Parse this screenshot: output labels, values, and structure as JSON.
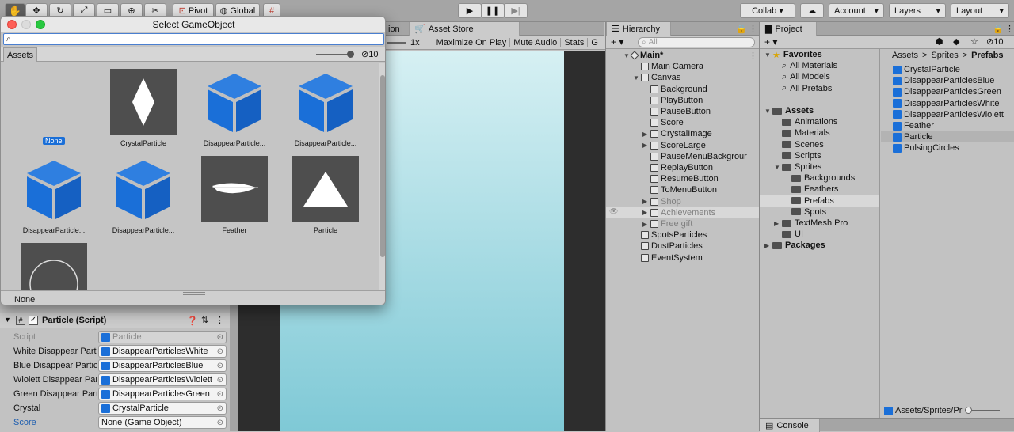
{
  "toolbar": {
    "pivot": "Pivot",
    "global": "Global",
    "collab": "Collab ▾",
    "account": "Account",
    "layers": "Layers",
    "layout": "Layout"
  },
  "game_view": {
    "tab_asset_store": "Asset Store",
    "zoom": "1x",
    "maximize": "Maximize On Play",
    "mute": "Mute Audio",
    "stats": "Stats",
    "gizmos": "G"
  },
  "hierarchy": {
    "title": "Hierarchy",
    "search_placeholder": "All",
    "add": "+ ▾",
    "items": [
      {
        "label": "Main*",
        "depth": 0,
        "arrow": "▼",
        "bold": true,
        "icon": "unity-scene-icon"
      },
      {
        "label": "Main Camera",
        "depth": 1,
        "arrow": "",
        "icon": "cube-icon"
      },
      {
        "label": "Canvas",
        "depth": 1,
        "arrow": "▼",
        "icon": "cube-icon"
      },
      {
        "label": "Background",
        "depth": 2,
        "arrow": "",
        "icon": "cube-icon"
      },
      {
        "label": "PlayButton",
        "depth": 2,
        "arrow": "",
        "icon": "cube-icon"
      },
      {
        "label": "PauseButton",
        "depth": 2,
        "arrow": "",
        "icon": "cube-icon"
      },
      {
        "label": "Score",
        "depth": 2,
        "arrow": "",
        "icon": "cube-icon"
      },
      {
        "label": "CrystalImage",
        "depth": 2,
        "arrow": "▶",
        "icon": "cube-icon"
      },
      {
        "label": "ScoreLarge",
        "depth": 2,
        "arrow": "▶",
        "icon": "cube-icon"
      },
      {
        "label": "PauseMenuBackgrour",
        "depth": 2,
        "arrow": "",
        "icon": "cube-icon"
      },
      {
        "label": "ReplayButton",
        "depth": 2,
        "arrow": "",
        "icon": "cube-icon"
      },
      {
        "label": "ResumeButton",
        "depth": 2,
        "arrow": "",
        "icon": "cube-icon"
      },
      {
        "label": "ToMenuButton",
        "depth": 2,
        "arrow": "",
        "icon": "cube-icon"
      },
      {
        "label": "Shop",
        "depth": 2,
        "arrow": "▶",
        "gray": true,
        "icon": "cube-icon"
      },
      {
        "label": "Achievements",
        "depth": 2,
        "arrow": "▶",
        "gray": true,
        "selected": true,
        "icon": "cube-icon"
      },
      {
        "label": "Free gift",
        "depth": 2,
        "arrow": "▶",
        "gray": true,
        "icon": "cube-icon"
      },
      {
        "label": "SpotsParticles",
        "depth": 1,
        "arrow": "",
        "icon": "cube-icon"
      },
      {
        "label": "DustParticles",
        "depth": 1,
        "arrow": "",
        "icon": "cube-icon"
      },
      {
        "label": "EventSystem",
        "depth": 1,
        "arrow": "",
        "icon": "cube-icon"
      }
    ]
  },
  "project": {
    "title": "Project",
    "add": "+ ▾",
    "count": "10",
    "tree": [
      {
        "label": "Favorites",
        "depth": 0,
        "arrow": "▼",
        "bold": true,
        "icon": "star-icon"
      },
      {
        "label": "All Materials",
        "depth": 1,
        "icon": "search-icon"
      },
      {
        "label": "All Models",
        "depth": 1,
        "icon": "search-icon"
      },
      {
        "label": "All Prefabs",
        "depth": 1,
        "icon": "search-icon"
      },
      {
        "label": "",
        "depth": 0,
        "icon": ""
      },
      {
        "label": "Assets",
        "depth": 0,
        "arrow": "▼",
        "bold": true,
        "icon": "folder-icon"
      },
      {
        "label": "Animations",
        "depth": 1,
        "icon": "folder-icon"
      },
      {
        "label": "Materials",
        "depth": 1,
        "icon": "folder-icon"
      },
      {
        "label": "Scenes",
        "depth": 1,
        "icon": "folder-icon"
      },
      {
        "label": "Scripts",
        "depth": 1,
        "icon": "folder-icon"
      },
      {
        "label": "Sprites",
        "depth": 1,
        "arrow": "▼",
        "icon": "folder-icon"
      },
      {
        "label": "Backgrounds",
        "depth": 2,
        "icon": "folder-icon"
      },
      {
        "label": "Feathers",
        "depth": 2,
        "icon": "folder-icon"
      },
      {
        "label": "Prefabs",
        "depth": 2,
        "icon": "folder-icon",
        "selected": true
      },
      {
        "label": "Spots",
        "depth": 2,
        "icon": "folder-icon"
      },
      {
        "label": "TextMesh Pro",
        "depth": 1,
        "arrow": "▶",
        "icon": "folder-icon"
      },
      {
        "label": "UI",
        "depth": 1,
        "icon": "folder-icon"
      },
      {
        "label": "Packages",
        "depth": 0,
        "arrow": "▶",
        "bold": true,
        "icon": "folder-icon"
      }
    ],
    "breadcrumb": [
      "Assets",
      ">",
      "Sprites",
      ">",
      "Prefabs"
    ],
    "files": [
      {
        "label": "CrystalParticle"
      },
      {
        "label": "DisappearParticlesBlue"
      },
      {
        "label": "DisappearParticlesGreen"
      },
      {
        "label": "DisappearParticlesWhite"
      },
      {
        "label": "DisappearParticlesWiolett"
      },
      {
        "label": "Feather"
      },
      {
        "label": "Particle",
        "selected": true
      },
      {
        "label": "PulsingCircles"
      }
    ],
    "footer_path": "Assets/Sprites/Pr",
    "console": "Console"
  },
  "inspector": {
    "component": "Particle (Script)",
    "fields": [
      {
        "label": "Script",
        "value": "Particle",
        "gray": true
      },
      {
        "label": "White Disappear Part",
        "value": "DisappearParticlesWhite"
      },
      {
        "label": "Blue Disappear Partic",
        "value": "DisappearParticlesBlue"
      },
      {
        "label": "Wiolett Disappear Par",
        "value": "DisappearParticlesWiolett"
      },
      {
        "label": "Green Disappear Part",
        "value": "DisappearParticlesGreen"
      },
      {
        "label": "Crystal",
        "value": "CrystalParticle"
      },
      {
        "label": "Score",
        "value": "None (Game Object)",
        "blue_label": true,
        "no_icon": true
      }
    ]
  },
  "dialog": {
    "title": "Select GameObject",
    "search_value": "",
    "tab_assets": "Assets",
    "count": "10",
    "footer": "None",
    "items": [
      {
        "label": "None",
        "kind": "none"
      },
      {
        "label": "CrystalParticle",
        "kind": "diamond"
      },
      {
        "label": "DisappearParticle...",
        "kind": "cube"
      },
      {
        "label": "DisappearParticle...",
        "kind": "cube"
      },
      {
        "label": "DisappearParticle...",
        "kind": "cube"
      },
      {
        "label": "DisappearParticle...",
        "kind": "cube"
      },
      {
        "label": "Feather",
        "kind": "feather"
      },
      {
        "label": "Particle",
        "kind": "triangle"
      },
      {
        "label": "",
        "kind": "circle"
      }
    ]
  },
  "colors": {
    "accent": "#1a6fd8",
    "selected_file": "#b3b3b3",
    "game_bg": "#8fd0dc"
  }
}
